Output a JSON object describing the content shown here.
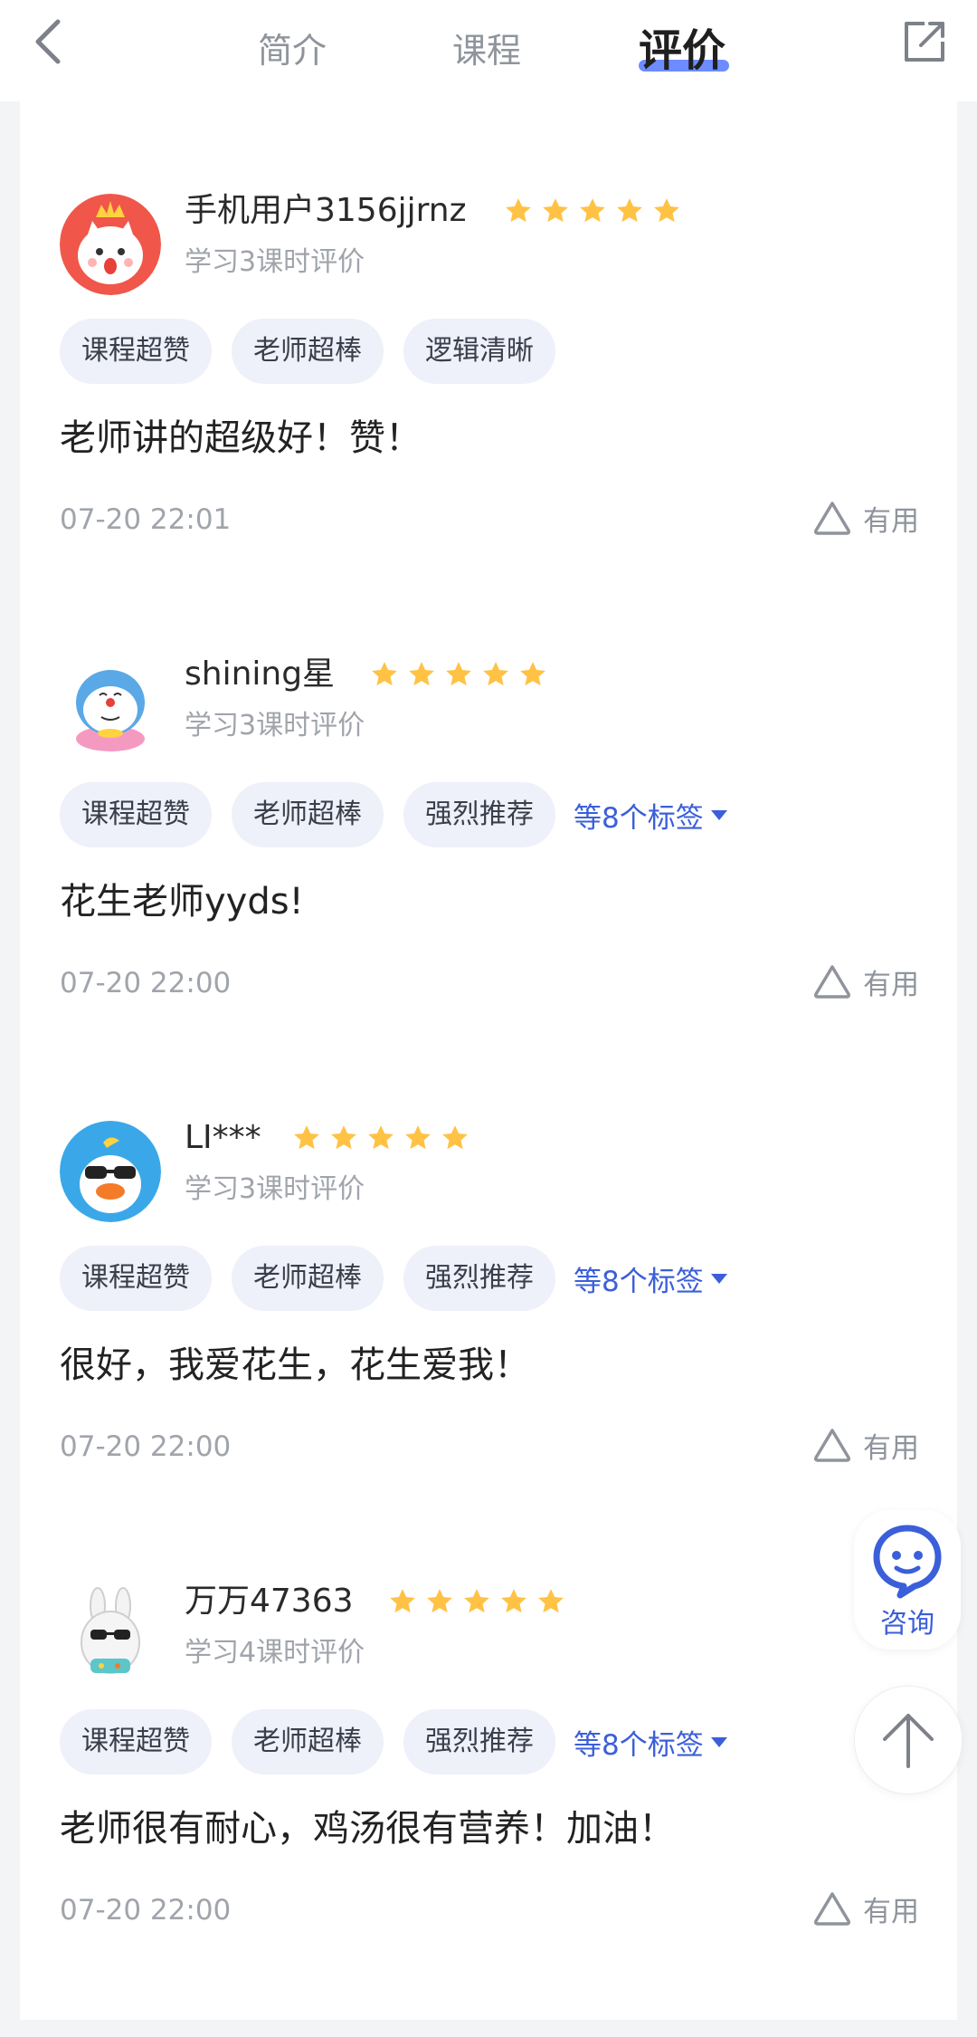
{
  "tabs": [
    {
      "label": "简介"
    },
    {
      "label": "课程"
    },
    {
      "label": "评价"
    }
  ],
  "active_tab": "评价",
  "colors": {
    "accent": "#3b5fd9",
    "tab_underline": "#6c8cff",
    "star": "#ffc244",
    "tag_bg": "#eef0fa"
  },
  "icons": [
    "back-icon",
    "share-icon",
    "star-icon",
    "caret-down-icon",
    "useful-icon",
    "consult-icon",
    "arrow-up-icon"
  ],
  "reviews": [
    {
      "username": "手机用户3156jjrnz",
      "stars": 5,
      "meta": "学习3课时评价",
      "tags": [
        "课程超赞",
        "老师超棒",
        "逻辑清晰"
      ],
      "more_tags": "",
      "content": "老师讲的超级好！赞！",
      "date": "07-20 22:01",
      "useful_label": "有用"
    },
    {
      "username": "shining星",
      "stars": 5,
      "meta": "学习3课时评价",
      "tags": [
        "课程超赞",
        "老师超棒",
        "强烈推荐"
      ],
      "more_tags": "等8个标签",
      "content": "花生老师yyds!",
      "date": "07-20 22:00",
      "useful_label": "有用"
    },
    {
      "username": "LI***",
      "stars": 5,
      "meta": "学习3课时评价",
      "tags": [
        "课程超赞",
        "老师超棒",
        "强烈推荐"
      ],
      "more_tags": "等8个标签",
      "content": "很好，我爱花生，花生爱我！",
      "date": "07-20 22:00",
      "useful_label": "有用"
    },
    {
      "username": "万万47363",
      "stars": 5,
      "meta": "学习4课时评价",
      "tags": [
        "课程超赞",
        "老师超棒",
        "强烈推荐"
      ],
      "more_tags": "等8个标签",
      "content": "老师很有耐心，鸡汤很有营养！加油！",
      "date": "07-20 22:00",
      "useful_label": "有用"
    }
  ],
  "consult": {
    "label": "咨询"
  }
}
